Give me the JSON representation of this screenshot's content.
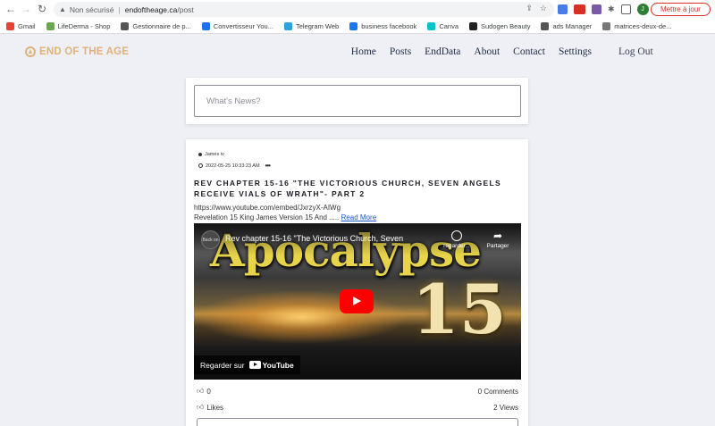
{
  "browser": {
    "security_label": "Non sécurisé",
    "url_domain": "endoftheage.ca",
    "url_path": "/post",
    "update_label": "Mettre à jour",
    "avatar_letter": "J",
    "bookmarks": [
      {
        "label": "Gmail",
        "color": "#ea4335"
      },
      {
        "label": "LifeDerma - Shop",
        "color": "#6aa84f"
      },
      {
        "label": "Gestionnaire de p...",
        "color": "#555555"
      },
      {
        "label": "Convertisseur You...",
        "color": "#1a73e8"
      },
      {
        "label": "Telegram Web",
        "color": "#2aa3df"
      },
      {
        "label": "business facebook",
        "color": "#1877f2"
      },
      {
        "label": "Canva",
        "color": "#00c4cc"
      },
      {
        "label": "Sudogen Beauty",
        "color": "#222222"
      },
      {
        "label": "ads Manager",
        "color": "#555555"
      },
      {
        "label": "matrices-deux-de...",
        "color": "#777777"
      }
    ]
  },
  "site": {
    "logo": "END OF THE AGE",
    "nav": [
      "Home",
      "Posts",
      "EndData",
      "About",
      "Contact",
      "Settings"
    ],
    "logout": "Log Out",
    "accent": "#e0b27a"
  },
  "composer": {
    "placeholder": "What's News?"
  },
  "post": {
    "author": "James iv",
    "timestamp": "2022-05-25 10:33:23 AM",
    "more": "•••",
    "title": "REV CHAPTER 15-16 \"THE VICTORIOUS CHURCH, SEVEN ANGELS RECEIVE VIALS OF WRATH\"- PART 2",
    "link": "https://www.youtube.com/embed/JxrzyX-AIWg",
    "excerpt": "Revelation 15 King James Version 15 And .....",
    "read_more": "Read More",
    "video": {
      "title": "Rev chapter 15-16 \"The Victorious Church, Seven",
      "channel_badge": "Back on",
      "overlay_word": "Apocalypse",
      "overlay_number": "15",
      "watch_later": "regarder...",
      "share": "Partager",
      "watch_on": "Regarder sur",
      "yt": "YouTube"
    },
    "likes_count": "0",
    "comments": "0 Comments",
    "likes_label": "Likes",
    "views": "2 Views"
  }
}
